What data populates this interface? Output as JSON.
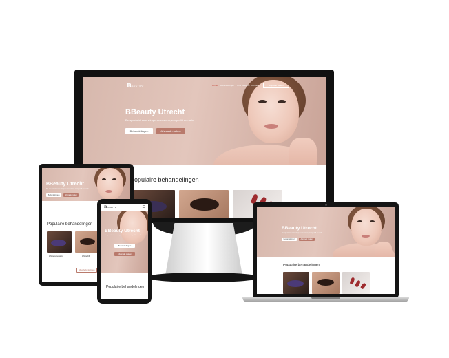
{
  "site": {
    "logo": "BEAUTY",
    "hero_title": "BBeauty Utrecht",
    "hero_subtitle": "De specialist voor wimperextensions, wimperlift en nails",
    "primary_button": "Behandelingen",
    "secondary_button": "Afspraak maken",
    "section_title": "Populaire behandelingen",
    "nav": [
      "Home",
      "Behandelingen",
      "Over BBeauty",
      "Contact",
      "Afspraak maken"
    ]
  },
  "tablet": {
    "captions": [
      "Wimperextensions",
      "Wimperlift"
    ],
    "outline_button": "Meer behandelingen"
  },
  "colors": {
    "accent": "#b97a6c",
    "hero_background": "#dcbdb2",
    "device_frame": "#151515"
  }
}
